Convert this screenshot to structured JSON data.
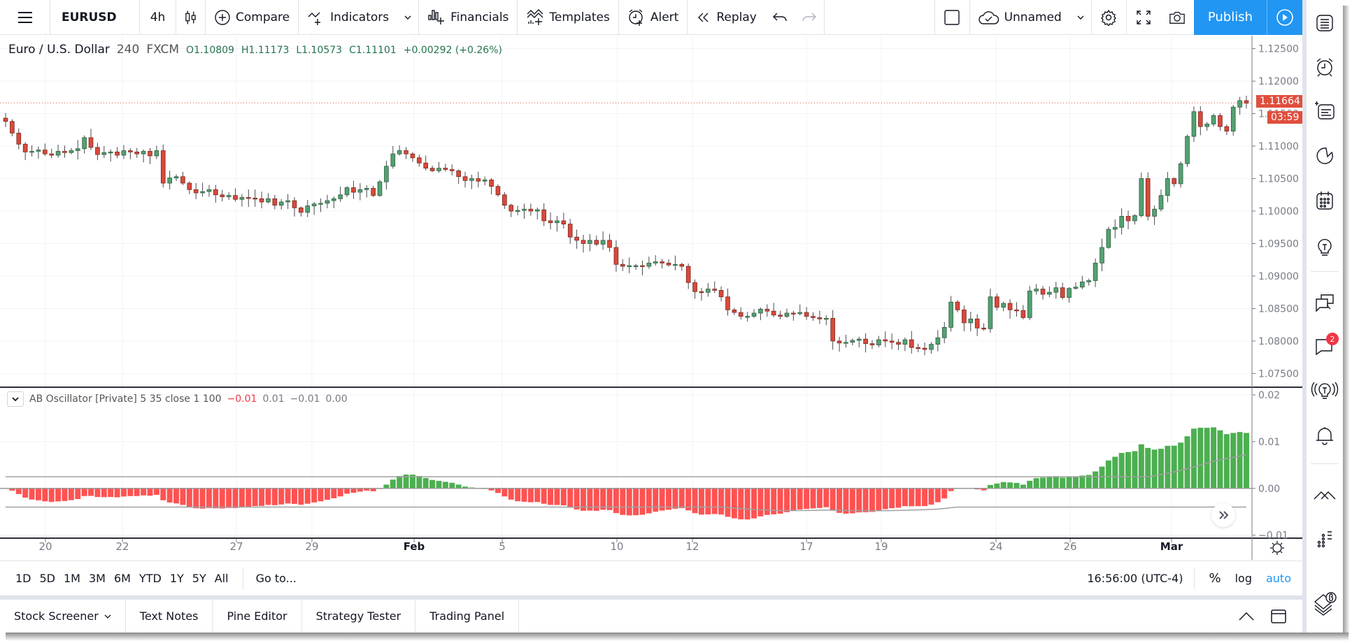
{
  "toolbar": {
    "symbol": "EURUSD",
    "interval": "4h",
    "compare_label": "Compare",
    "indicators_label": "Indicators",
    "financials_label": "Financials",
    "templates_label": "Templates",
    "alert_label": "Alert",
    "replay_label": "Replay",
    "layout_name": "Unnamed",
    "publish_label": "Publish",
    "icons": [
      "menu-icon",
      "candles-icon",
      "plus-circle-icon",
      "indicators-icon",
      "chevron-down-icon",
      "financials-icon",
      "templates-icon",
      "alarm-icon",
      "replay-icon",
      "undo-icon",
      "redo-icon",
      "square-icon",
      "cloud-check-icon",
      "gear-icon",
      "fullscreen-icon",
      "camera-icon",
      "play-icon"
    ]
  },
  "legend": {
    "title": "Euro / U.S. Dollar",
    "interval": "240",
    "exchange": "FXCM",
    "open": "O1.10809",
    "high": "H1.11173",
    "low": "L1.10573",
    "close": "C1.11101",
    "change": "+0.00292 (+0.26%)"
  },
  "price_scale": {
    "labels": [
      "1.12500",
      "1.12000",
      "1.11500",
      "1.11000",
      "1.10500",
      "1.10000",
      "1.09500",
      "1.09000",
      "1.08500",
      "1.08000",
      "1.07500"
    ],
    "last_price": "1.11664",
    "countdown": "03:59"
  },
  "oscillator": {
    "name": "AB Oscillator [Private] 5 35 close 1 100",
    "values": [
      "−0.01",
      "0.01",
      "−0.01",
      "0.00"
    ],
    "value_colors": [
      "#f23645",
      "#787b86",
      "#787b86",
      "#787b86"
    ],
    "scale_labels": [
      "0.02",
      "0.01",
      "0.00",
      "−0.01"
    ]
  },
  "time_axis": {
    "labels": [
      "20",
      "22",
      "27",
      "29",
      "Feb",
      "5",
      "10",
      "12",
      "17",
      "19",
      "24",
      "26",
      "Mar"
    ],
    "bold": [
      "Feb",
      "Mar"
    ]
  },
  "range_bar": {
    "ranges": [
      "1D",
      "5D",
      "1M",
      "3M",
      "6M",
      "YTD",
      "1Y",
      "5Y",
      "All"
    ],
    "goto_label": "Go to...",
    "clock": "16:56:00 (UTC-4)",
    "percent_label": "%",
    "log_label": "log",
    "auto_label": "auto"
  },
  "bottom_tabs": [
    "Stock Screener",
    "Text Notes",
    "Pine Editor",
    "Strategy Tester",
    "Trading Panel"
  ],
  "sidebar": {
    "icons": [
      "watchlist-icon",
      "alarm-clock-icon",
      "data-window-icon",
      "hotlist-icon",
      "calendar-icon",
      "ideas-icon",
      "chats-icon",
      "private-chat-icon",
      "streams-icon",
      "notifications-icon",
      "order-panel-icon",
      "dom-icon",
      "layers-beta-icon"
    ],
    "chat_badge": "2"
  },
  "colors": {
    "up": "#53a172",
    "down": "#d9493b",
    "osc_up": "#4caf50",
    "osc_down": "#ff5252",
    "accent": "#2196f3",
    "price_tag": "#e04e3d"
  },
  "chart_data": {
    "type": "candlestick",
    "symbol": "EURUSD",
    "timeframe": "4h",
    "ylim": [
      1.073,
      1.127
    ],
    "closes": [
      1.1138,
      1.112,
      1.1103,
      1.1091,
      1.1092,
      1.1094,
      1.1088,
      1.1086,
      1.1092,
      1.109,
      1.1093,
      1.1096,
      1.1113,
      1.1098,
      1.1087,
      1.109,
      1.1091,
      1.1086,
      1.1093,
      1.1091,
      1.1088,
      1.1092,
      1.1085,
      1.1093,
      1.1043,
      1.1051,
      1.1053,
      1.1043,
      1.1033,
      1.1028,
      1.103,
      1.1033,
      1.1025,
      1.1022,
      1.1024,
      1.1018,
      1.1021,
      1.102,
      1.1019,
      1.1014,
      1.1019,
      1.1009,
      1.1014,
      1.1016,
      1.1005,
      1.0998,
      1.1008,
      1.1011,
      1.1012,
      1.1016,
      1.1019,
      1.1025,
      1.1036,
      1.1029,
      1.1033,
      1.1035,
      1.1024,
      1.1045,
      1.1069,
      1.1088,
      1.1093,
      1.1088,
      1.1082,
      1.1074,
      1.1066,
      1.1062,
      1.1066,
      1.1064,
      1.1062,
      1.1053,
      1.1047,
      1.105,
      1.1046,
      1.1048,
      1.1038,
      1.1025,
      1.1009,
      1.1,
      1.1001,
      1.1003,
      1.1,
      1.1002,
      1.0985,
      1.0982,
      1.0985,
      1.098,
      1.096,
      1.0955,
      1.095,
      1.0955,
      1.0949,
      1.0955,
      1.0944,
      1.0918,
      1.0915,
      1.0916,
      1.0916,
      1.0915,
      1.092,
      1.0922,
      1.092,
      1.0917,
      1.0918,
      1.0915,
      1.089,
      1.0876,
      1.0875,
      1.088,
      1.0878,
      1.0868,
      1.0848,
      1.0844,
      1.0838,
      1.0838,
      1.0843,
      1.0849,
      1.0846,
      1.084,
      1.0838,
      1.0843,
      1.0842,
      1.0844,
      1.0838,
      1.0836,
      1.0834,
      1.0835,
      1.08,
      1.0797,
      1.0798,
      1.0801,
      1.0803,
      1.0796,
      1.0794,
      1.0802,
      1.08,
      1.0798,
      1.0795,
      1.0802,
      1.079,
      1.0789,
      1.0787,
      1.0795,
      1.0805,
      1.0821,
      1.086,
      1.0848,
      1.0828,
      1.0834,
      1.082,
      1.0819,
      1.0868,
      1.0852,
      1.0858,
      1.0848,
      1.0847,
      1.0836,
      1.0877,
      1.088,
      1.0872,
      1.0875,
      1.0882,
      1.0867,
      1.0881,
      1.0883,
      1.0891,
      1.0893,
      1.092,
      1.0944,
      1.0972,
      1.0975,
      1.0992,
      1.0985,
      1.0993,
      1.105,
      1.0992,
      1.1003,
      1.1024,
      1.105,
      1.1042,
      1.1073,
      1.1115,
      1.1153,
      1.113,
      1.1134,
      1.1147,
      1.113,
      1.1123,
      1.116,
      1.117,
      1.1166
    ],
    "oscillator": {
      "type": "histogram",
      "ylim": [
        -0.0105,
        0.0215
      ],
      "note": "Histogram of AB Oscillator; positive bars green, negative red, with upper and lower gray signal bands",
      "upper_band_level": 0.0025,
      "lower_band_level": -0.004
    }
  }
}
